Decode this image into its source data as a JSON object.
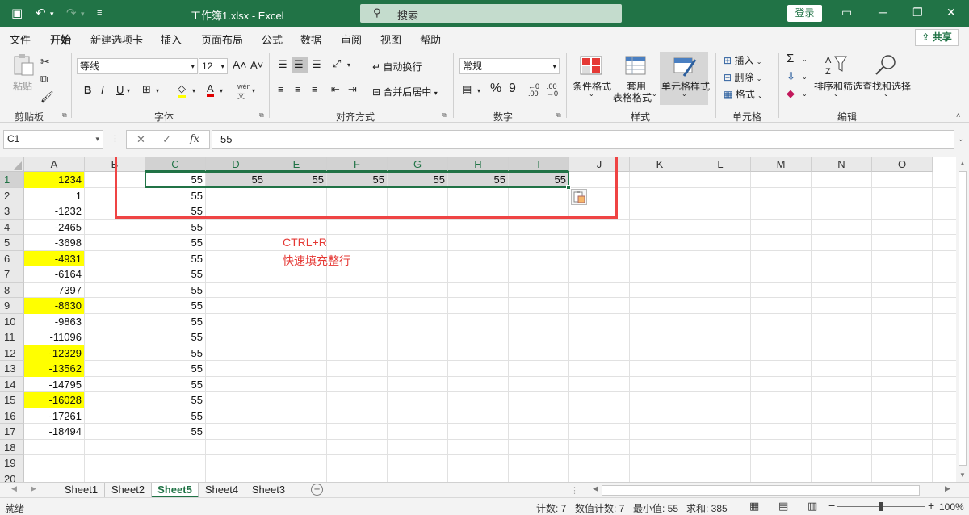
{
  "titlebar": {
    "title": "工作簿1.xlsx  -  Excel",
    "search_placeholder": "搜索",
    "login": "登录"
  },
  "menu": {
    "tabs": [
      "文件",
      "开始",
      "新建选项卡",
      "插入",
      "页面布局",
      "公式",
      "数据",
      "审阅",
      "视图",
      "帮助"
    ],
    "active_index": 1,
    "share": "共享"
  },
  "ribbon": {
    "clipboard": {
      "label": "剪贴板",
      "paste": "粘贴"
    },
    "font": {
      "label": "字体",
      "font_name": "等线",
      "font_size": "12",
      "bold": "B",
      "italic": "I",
      "underline": "U"
    },
    "alignment": {
      "label": "对齐方式",
      "wrap_text": "自动换行",
      "merge_center": "合并后居中"
    },
    "number": {
      "label": "数字",
      "format": "常规",
      "percent": "%",
      "comma": "9"
    },
    "styles": {
      "label": "样式",
      "conditional": "条件格式",
      "table_format_1": "套用",
      "table_format_2": "表格格式",
      "cell_styles": "单元格样式"
    },
    "cells": {
      "label": "单元格",
      "insert": "插入",
      "delete": "删除",
      "format": "格式"
    },
    "editing": {
      "label": "编辑",
      "sort_filter": "排序和筛选",
      "find_select": "查找和选择"
    }
  },
  "formula_bar": {
    "name_box": "C1",
    "value": "55",
    "fx": "fx"
  },
  "grid": {
    "columns": [
      "A",
      "B",
      "C",
      "D",
      "E",
      "F",
      "G",
      "H",
      "I",
      "J",
      "K",
      "L",
      "M",
      "N",
      "O"
    ],
    "selected_columns": [
      "C",
      "D",
      "E",
      "F",
      "G",
      "H",
      "I"
    ],
    "rows": [
      "1",
      "2",
      "3",
      "4",
      "5",
      "6",
      "7",
      "8",
      "9",
      "10",
      "11",
      "12",
      "13",
      "14",
      "15",
      "16",
      "17",
      "18",
      "19",
      "20"
    ],
    "col_a": [
      "1234",
      "1",
      "-1232",
      "-2465",
      "-3698",
      "-4931",
      "-6164",
      "-7397",
      "-8630",
      "-9863",
      "-11096",
      "-12329",
      "-13562",
      "-14795",
      "-16028",
      "-17261",
      "-18494"
    ],
    "col_a_yellow_rows": [
      1,
      6,
      9,
      12,
      13,
      15
    ],
    "col_c": [
      "55",
      "55",
      "55",
      "55",
      "55",
      "55",
      "55",
      "55",
      "55",
      "55",
      "55",
      "55",
      "55",
      "55",
      "55",
      "55",
      "55"
    ],
    "row1_filled": [
      "55",
      "55",
      "55",
      "55",
      "55",
      "55"
    ]
  },
  "annotation": {
    "line1": "CTRL+R",
    "line2": "快速填充整行"
  },
  "sheets": {
    "tabs": [
      "Sheet1",
      "Sheet2",
      "Sheet5",
      "Sheet4",
      "Sheet3"
    ],
    "active_index": 2
  },
  "status": {
    "ready": "就绪",
    "count": "计数: 7",
    "numeric_count": "数值计数: 7",
    "min": "最小值: 55",
    "sum": "求和: 385",
    "zoom": "100%"
  },
  "colors": {
    "accent": "#217346",
    "highlight_yellow": "#ffff00",
    "annotation_red": "#ef4444"
  }
}
